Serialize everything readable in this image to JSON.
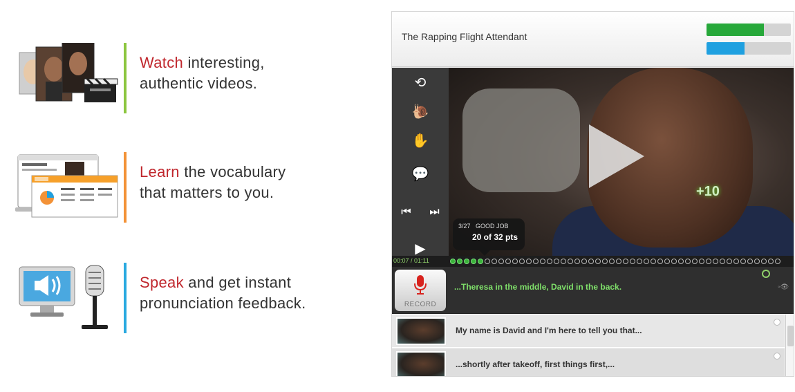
{
  "features": [
    {
      "highlight": "Watch",
      "line1_rest": " interesting,",
      "line2": "authentic videos.",
      "accent": "#8cc63f"
    },
    {
      "highlight": "Learn",
      "line1_rest": " the vocabulary",
      "line2": "that matters to you.",
      "accent": "#f39237"
    },
    {
      "highlight": "Speak",
      "line1_rest": " and get instant",
      "line2": "pronunciation feedback.",
      "accent": "#29a9e0"
    }
  ],
  "player": {
    "title": "The Rapping Flight Attendant",
    "meters": [
      {
        "progress": 0.68,
        "color": "#27a83a"
      },
      {
        "progress": 0.45,
        "color": "#1fa0e0"
      }
    ],
    "icons": {
      "replay": "replay-icon",
      "slow": "snail-icon",
      "hand": "hand-icon",
      "chat": "chat-bubbles-icon",
      "prev": "previous-icon",
      "next": "next-icon",
      "play": "play-icon"
    },
    "video_points": "+10",
    "tooltip": {
      "count": "3/27",
      "status": "GOOD JOB",
      "score": "20 of 32 pts"
    },
    "timecode": "00:07 / 01:11",
    "record_label": "RECORD",
    "active_line": "...Theresa in the middle, David in the back.",
    "lines": [
      "My name is David and I'm here to tell you that...",
      "...shortly after takeoff, first things first,..."
    ]
  }
}
